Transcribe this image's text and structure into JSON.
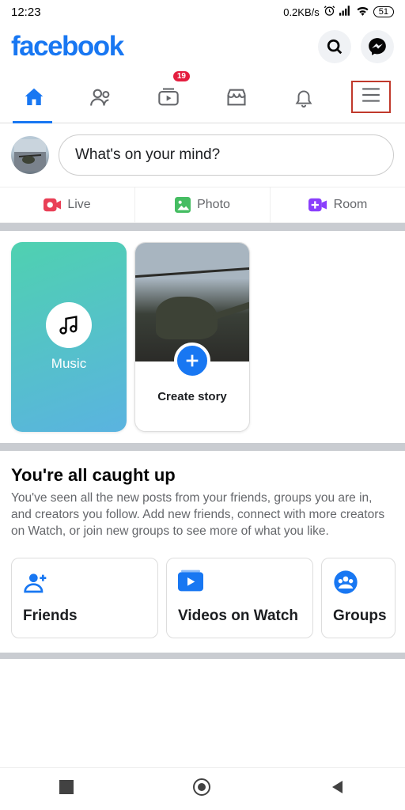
{
  "status": {
    "time": "12:23",
    "net": "0.2KB/s",
    "battery": "51"
  },
  "brand": "facebook",
  "tabs": {
    "watch_badge": "19"
  },
  "composer": {
    "placeholder": "What's on your mind?"
  },
  "actions": {
    "live": "Live",
    "photo": "Photo",
    "room": "Room"
  },
  "stories": {
    "music": "Music",
    "create": "Create story"
  },
  "caught_up": {
    "title": "You're all caught up",
    "desc": "You've seen all the new posts from your friends, groups you are in, and creators you follow. Add new friends, connect with more creators on Watch, or join new groups to see more of what you like."
  },
  "suggestions": {
    "friends": "Friends",
    "videos": "Videos on Watch",
    "groups": "Groups"
  },
  "colors": {
    "brand": "#1877f2",
    "badge": "#e41e3f"
  }
}
